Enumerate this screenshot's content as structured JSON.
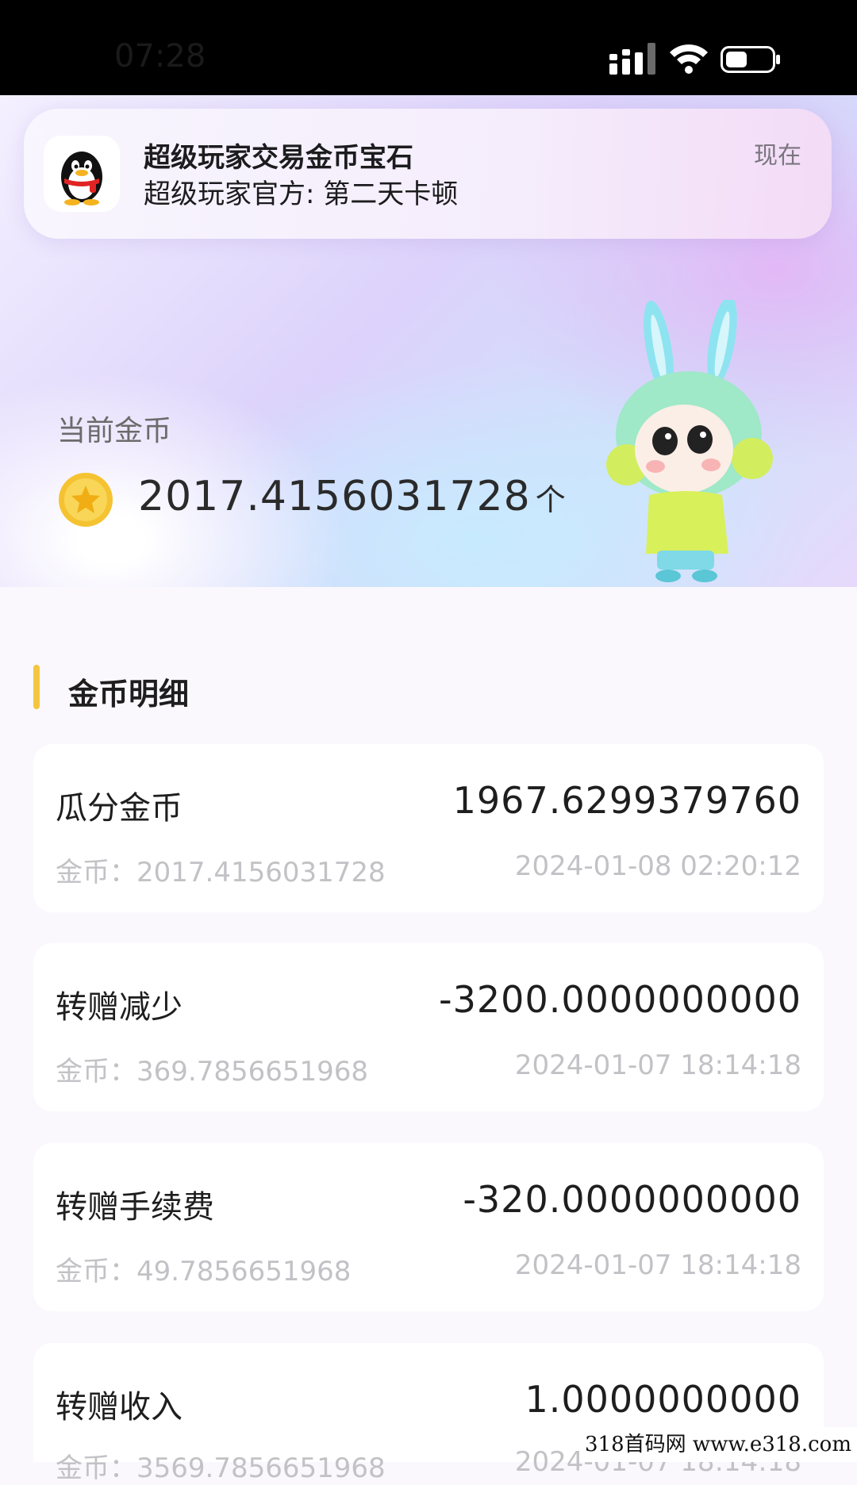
{
  "status_bar": {
    "time": "07:28"
  },
  "notification": {
    "title": "超级玩家交易金币宝石",
    "body": "超级玩家官方: 第二天卡顿",
    "time": "现在",
    "app_icon": "qq-penguin-icon"
  },
  "summary": {
    "label": "当前金币",
    "value": "2017.4156031728",
    "unit": "个"
  },
  "section": {
    "title": "金币明细"
  },
  "balance_prefix": "金币：",
  "records": [
    {
      "title": "瓜分金币",
      "amount": "1967.6299379760",
      "balance": "2017.4156031728",
      "time": "2024-01-08 02:20:12"
    },
    {
      "title": "转赠减少",
      "amount": "-3200.0000000000",
      "balance": "369.7856651968",
      "time": "2024-01-07 18:14:18"
    },
    {
      "title": "转赠手续费",
      "amount": "-320.0000000000",
      "balance": "49.7856651968",
      "time": "2024-01-07 18:14:18"
    },
    {
      "title": "转赠收入",
      "amount": "1.0000000000",
      "balance": "3569.7856651968",
      "time": "2024-01-07 18:14:18"
    }
  ],
  "watermark": "318首码网 www.e318.com",
  "colors": {
    "accent_bar": "#f4c542",
    "coin": "#f5c331"
  }
}
